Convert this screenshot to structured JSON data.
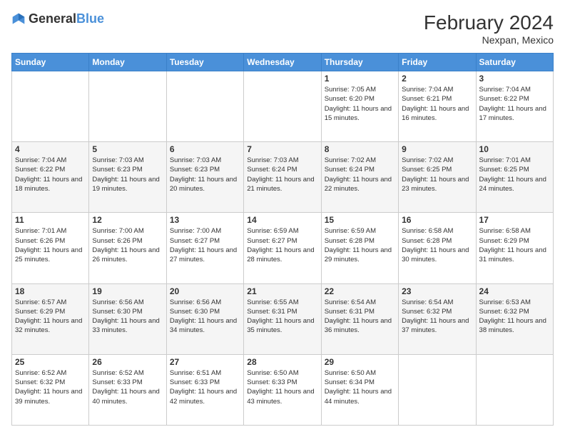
{
  "header": {
    "logo_general": "General",
    "logo_blue": "Blue",
    "month_year": "February 2024",
    "location": "Nexpan, Mexico"
  },
  "days_of_week": [
    "Sunday",
    "Monday",
    "Tuesday",
    "Wednesday",
    "Thursday",
    "Friday",
    "Saturday"
  ],
  "weeks": [
    [
      {
        "day": "",
        "info": ""
      },
      {
        "day": "",
        "info": ""
      },
      {
        "day": "",
        "info": ""
      },
      {
        "day": "",
        "info": ""
      },
      {
        "day": "1",
        "info": "Sunrise: 7:05 AM\nSunset: 6:20 PM\nDaylight: 11 hours and 15 minutes."
      },
      {
        "day": "2",
        "info": "Sunrise: 7:04 AM\nSunset: 6:21 PM\nDaylight: 11 hours and 16 minutes."
      },
      {
        "day": "3",
        "info": "Sunrise: 7:04 AM\nSunset: 6:22 PM\nDaylight: 11 hours and 17 minutes."
      }
    ],
    [
      {
        "day": "4",
        "info": "Sunrise: 7:04 AM\nSunset: 6:22 PM\nDaylight: 11 hours and 18 minutes."
      },
      {
        "day": "5",
        "info": "Sunrise: 7:03 AM\nSunset: 6:23 PM\nDaylight: 11 hours and 19 minutes."
      },
      {
        "day": "6",
        "info": "Sunrise: 7:03 AM\nSunset: 6:23 PM\nDaylight: 11 hours and 20 minutes."
      },
      {
        "day": "7",
        "info": "Sunrise: 7:03 AM\nSunset: 6:24 PM\nDaylight: 11 hours and 21 minutes."
      },
      {
        "day": "8",
        "info": "Sunrise: 7:02 AM\nSunset: 6:24 PM\nDaylight: 11 hours and 22 minutes."
      },
      {
        "day": "9",
        "info": "Sunrise: 7:02 AM\nSunset: 6:25 PM\nDaylight: 11 hours and 23 minutes."
      },
      {
        "day": "10",
        "info": "Sunrise: 7:01 AM\nSunset: 6:25 PM\nDaylight: 11 hours and 24 minutes."
      }
    ],
    [
      {
        "day": "11",
        "info": "Sunrise: 7:01 AM\nSunset: 6:26 PM\nDaylight: 11 hours and 25 minutes."
      },
      {
        "day": "12",
        "info": "Sunrise: 7:00 AM\nSunset: 6:26 PM\nDaylight: 11 hours and 26 minutes."
      },
      {
        "day": "13",
        "info": "Sunrise: 7:00 AM\nSunset: 6:27 PM\nDaylight: 11 hours and 27 minutes."
      },
      {
        "day": "14",
        "info": "Sunrise: 6:59 AM\nSunset: 6:27 PM\nDaylight: 11 hours and 28 minutes."
      },
      {
        "day": "15",
        "info": "Sunrise: 6:59 AM\nSunset: 6:28 PM\nDaylight: 11 hours and 29 minutes."
      },
      {
        "day": "16",
        "info": "Sunrise: 6:58 AM\nSunset: 6:28 PM\nDaylight: 11 hours and 30 minutes."
      },
      {
        "day": "17",
        "info": "Sunrise: 6:58 AM\nSunset: 6:29 PM\nDaylight: 11 hours and 31 minutes."
      }
    ],
    [
      {
        "day": "18",
        "info": "Sunrise: 6:57 AM\nSunset: 6:29 PM\nDaylight: 11 hours and 32 minutes."
      },
      {
        "day": "19",
        "info": "Sunrise: 6:56 AM\nSunset: 6:30 PM\nDaylight: 11 hours and 33 minutes."
      },
      {
        "day": "20",
        "info": "Sunrise: 6:56 AM\nSunset: 6:30 PM\nDaylight: 11 hours and 34 minutes."
      },
      {
        "day": "21",
        "info": "Sunrise: 6:55 AM\nSunset: 6:31 PM\nDaylight: 11 hours and 35 minutes."
      },
      {
        "day": "22",
        "info": "Sunrise: 6:54 AM\nSunset: 6:31 PM\nDaylight: 11 hours and 36 minutes."
      },
      {
        "day": "23",
        "info": "Sunrise: 6:54 AM\nSunset: 6:32 PM\nDaylight: 11 hours and 37 minutes."
      },
      {
        "day": "24",
        "info": "Sunrise: 6:53 AM\nSunset: 6:32 PM\nDaylight: 11 hours and 38 minutes."
      }
    ],
    [
      {
        "day": "25",
        "info": "Sunrise: 6:52 AM\nSunset: 6:32 PM\nDaylight: 11 hours and 39 minutes."
      },
      {
        "day": "26",
        "info": "Sunrise: 6:52 AM\nSunset: 6:33 PM\nDaylight: 11 hours and 40 minutes."
      },
      {
        "day": "27",
        "info": "Sunrise: 6:51 AM\nSunset: 6:33 PM\nDaylight: 11 hours and 42 minutes."
      },
      {
        "day": "28",
        "info": "Sunrise: 6:50 AM\nSunset: 6:33 PM\nDaylight: 11 hours and 43 minutes."
      },
      {
        "day": "29",
        "info": "Sunrise: 6:50 AM\nSunset: 6:34 PM\nDaylight: 11 hours and 44 minutes."
      },
      {
        "day": "",
        "info": ""
      },
      {
        "day": "",
        "info": ""
      }
    ]
  ]
}
